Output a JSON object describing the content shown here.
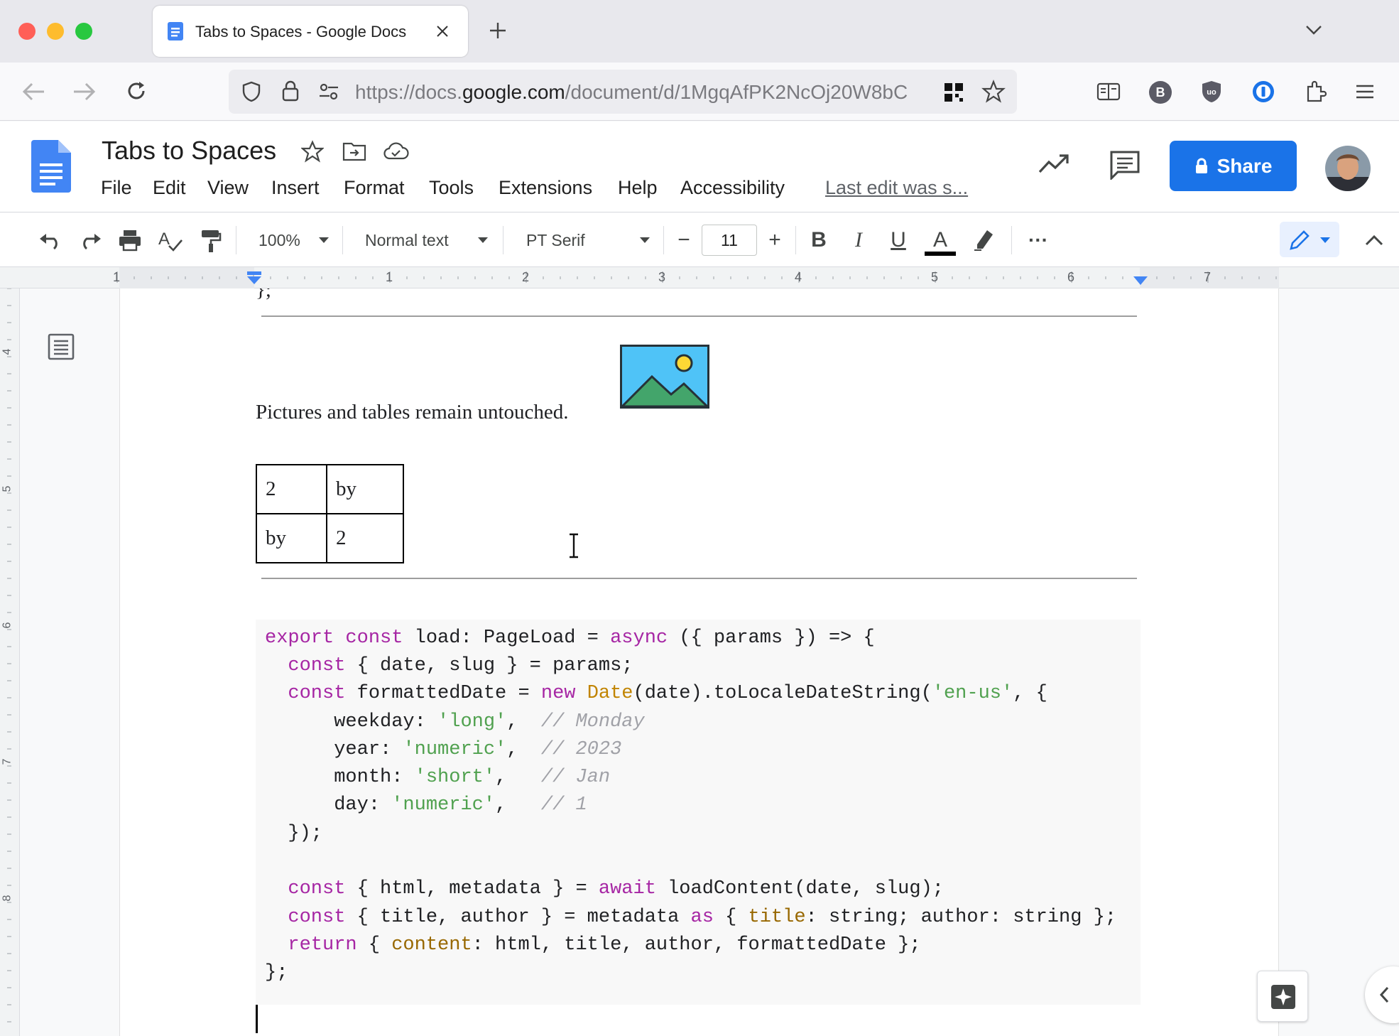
{
  "browser": {
    "tab_title": "Tabs to Spaces - Google Docs",
    "url_prefix": "https://docs.",
    "url_domain": "google.com",
    "url_path": "/document/d/1MgqAfPK2NcOj20W8bC"
  },
  "doc": {
    "title": "Tabs to Spaces",
    "menu": [
      "File",
      "Edit",
      "View",
      "Insert",
      "Format",
      "Tools",
      "Extensions",
      "Help",
      "Accessibility"
    ],
    "last_edit": "Last edit was s...",
    "share_label": "Share"
  },
  "toolbar": {
    "zoom": "100%",
    "style": "Normal text",
    "font": "PT Serif",
    "font_size": "11",
    "minus": "−",
    "plus": "+",
    "bold": "B",
    "italic": "I",
    "underline": "U",
    "textcolor": "A",
    "more": "···"
  },
  "ruler": {
    "h_numbers": [
      "1",
      "1",
      "2",
      "3",
      "4",
      "5",
      "6",
      "7"
    ],
    "v_numbers": [
      "4",
      "5",
      "6",
      "7",
      "8"
    ]
  },
  "content": {
    "top_fragment": "};",
    "paragraph": "Pictures and tables remain untouched.",
    "table": [
      [
        "2",
        "by"
      ],
      [
        "by",
        "2"
      ]
    ],
    "code_lines": [
      "export const load: PageLoad = async ({ params }) => {",
      "  const { date, slug } = params;",
      "  const formattedDate = new Date(date).toLocaleDateString('en-us', {",
      "      weekday: 'long',  // Monday",
      "      year: 'numeric',  // 2023",
      "      month: 'short',   // Jan",
      "      day: 'numeric',   // 1",
      "  });",
      "",
      "  const { html, metadata } = await loadContent(date, slug);",
      "  const { title, author } = metadata as { title: string; author: string };",
      "  return { content: html, title, author, formattedDate };",
      "};"
    ]
  },
  "colors": {
    "accent": "#1a73e8",
    "keyword": "#a626a4",
    "string": "#50a14f",
    "comment": "#a0a1a7",
    "type": "#c18401"
  }
}
